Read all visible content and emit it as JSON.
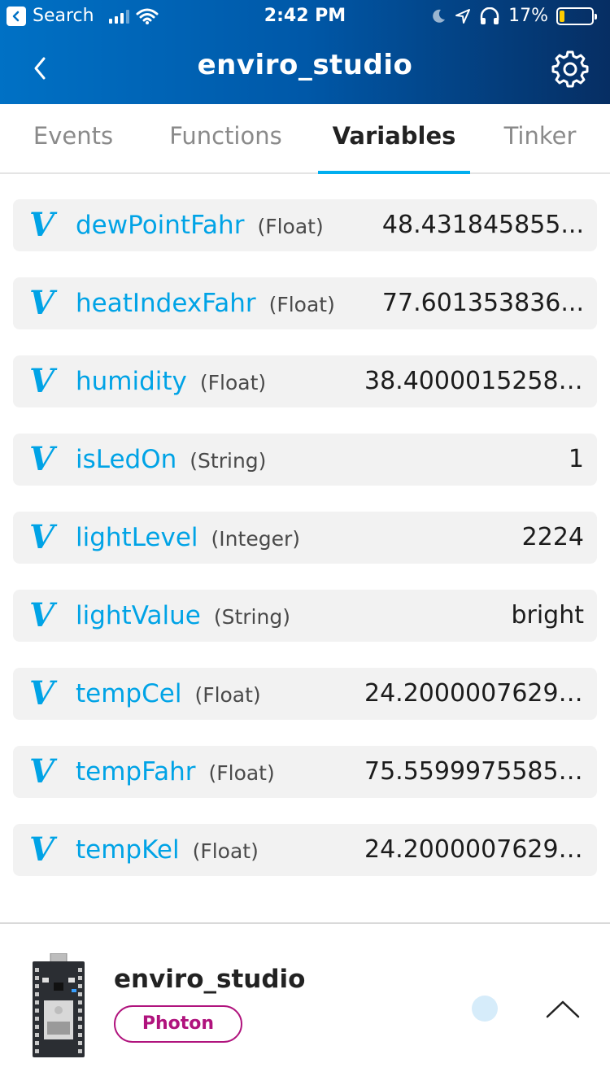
{
  "status_bar": {
    "back_app_label": "Search",
    "time": "2:42 PM",
    "battery_percent": "17%",
    "battery_level": 0.17
  },
  "nav": {
    "title": "enviro_studio",
    "back_icon": "chevron-left-icon",
    "settings_icon": "gear-icon"
  },
  "tabs": [
    {
      "label": "Events",
      "active": false
    },
    {
      "label": "Functions",
      "active": false
    },
    {
      "label": "Variables",
      "active": true
    },
    {
      "label": "Tinker",
      "active": false
    }
  ],
  "variables": [
    {
      "icon": "v-icon",
      "name": "dewPointFahr",
      "type": "(Float)",
      "value": "48.431845855..."
    },
    {
      "icon": "v-icon",
      "name": "heatIndexFahr",
      "type": "(Float)",
      "value": "77.601353836..."
    },
    {
      "icon": "v-icon",
      "name": "humidity",
      "type": "(Float)",
      "value": "38.40000152587891"
    },
    {
      "icon": "v-icon",
      "name": "isLedOn",
      "type": "(String)",
      "value": "1"
    },
    {
      "icon": "v-icon",
      "name": "lightLevel",
      "type": "(Integer)",
      "value": "2224"
    },
    {
      "icon": "v-icon",
      "name": "lightValue",
      "type": "(String)",
      "value": "bright"
    },
    {
      "icon": "v-icon",
      "name": "tempCel",
      "type": "(Float)",
      "value": "24.200000762939..."
    },
    {
      "icon": "v-icon",
      "name": "tempFahr",
      "type": "(Float)",
      "value": "75.559997558593..."
    },
    {
      "icon": "v-icon",
      "name": "tempKel",
      "type": "(Float)",
      "value": "24.20000076293945"
    }
  ],
  "variable_icon_glyph": "V",
  "footer": {
    "device_name": "enviro_studio",
    "device_type": "Photon",
    "device_icon": "photon-board-icon",
    "expand_icon": "chevron-up-icon"
  },
  "colors": {
    "accent": "#00a3e6",
    "tab_underline": "#00aeef",
    "badge": "#b0137d",
    "header_start": "#0071c5",
    "header_end": "#062e63"
  }
}
